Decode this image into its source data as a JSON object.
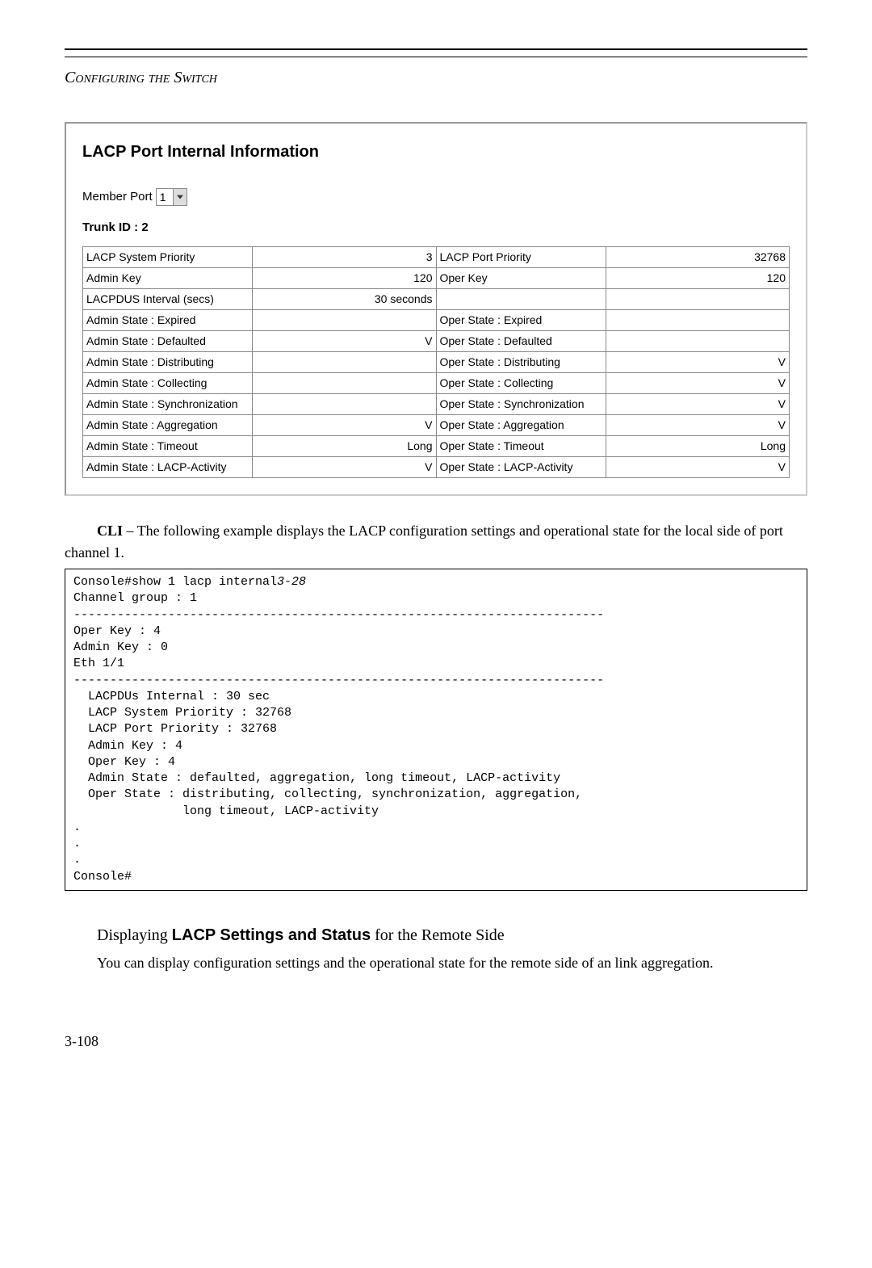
{
  "header": {
    "title": "Configuring the Switch"
  },
  "panel": {
    "title": "LACP Port Internal Information",
    "member_port_label": "Member Port",
    "member_port_value": "1",
    "trunk_id_label": "Trunk ID : 2",
    "rows": [
      {
        "l1": "LACP System Priority",
        "v1": "3",
        "l2": "LACP Port Priority",
        "v2": "32768"
      },
      {
        "l1": "Admin Key",
        "v1": "120",
        "l2": "Oper Key",
        "v2": "120"
      },
      {
        "l1": "LACPDUS Interval (secs)",
        "v1": "30 seconds",
        "l2": "",
        "v2": ""
      },
      {
        "l1": "Admin State : Expired",
        "v1": "",
        "l2": "Oper State : Expired",
        "v2": ""
      },
      {
        "l1": "Admin State : Defaulted",
        "v1": "V",
        "l2": "Oper State : Defaulted",
        "v2": ""
      },
      {
        "l1": "Admin State : Distributing",
        "v1": "",
        "l2": "Oper State : Distributing",
        "v2": "V"
      },
      {
        "l1": "Admin State : Collecting",
        "v1": "",
        "l2": "Oper State : Collecting",
        "v2": "V"
      },
      {
        "l1": "Admin State : Synchronization",
        "v1": "",
        "l2": "Oper State : Synchronization",
        "v2": "V"
      },
      {
        "l1": "Admin State : Aggregation",
        "v1": "V",
        "l2": "Oper State : Aggregation",
        "v2": "V"
      },
      {
        "l1": "Admin State : Timeout",
        "v1": "Long",
        "l2": "Oper State : Timeout",
        "v2": "Long"
      },
      {
        "l1": "Admin State : LACP-Activity",
        "v1": "V",
        "l2": "Oper State : LACP-Activity",
        "v2": "V"
      }
    ]
  },
  "body": {
    "cli_lead": "CLI",
    "cli_text1": " – The following example displays the LACP configuration settings and operational state for the local side of port channel 1.",
    "cli_output_cmd": "Console#show 1 lacp internal",
    "cli_output_ref": "3-28",
    "cli_output_rest": "\nChannel group : 1\n-------------------------------------------------------------------------\nOper Key : 4\nAdmin Key : 0\nEth 1/1\n-------------------------------------------------------------------------\n  LACPDUs Internal : 30 sec\n  LACP System Priority : 32768\n  LACP Port Priority : 32768\n  Admin Key : 4\n  Oper Key : 4\n  Admin State : defaulted, aggregation, long timeout, LACP-activity\n  Oper State : distributing, collecting, synchronization, aggregation,\n               long timeout, LACP-activity\n.\n.\n.\nConsole#",
    "section_head_pre": "Displaying ",
    "section_head_bold": "LACP Settings and Status",
    "section_head_post": " for the Remote Side",
    "section_body": "You can display configuration settings and the operational state for the remote side of an link aggregation."
  },
  "page_number": "3-108"
}
